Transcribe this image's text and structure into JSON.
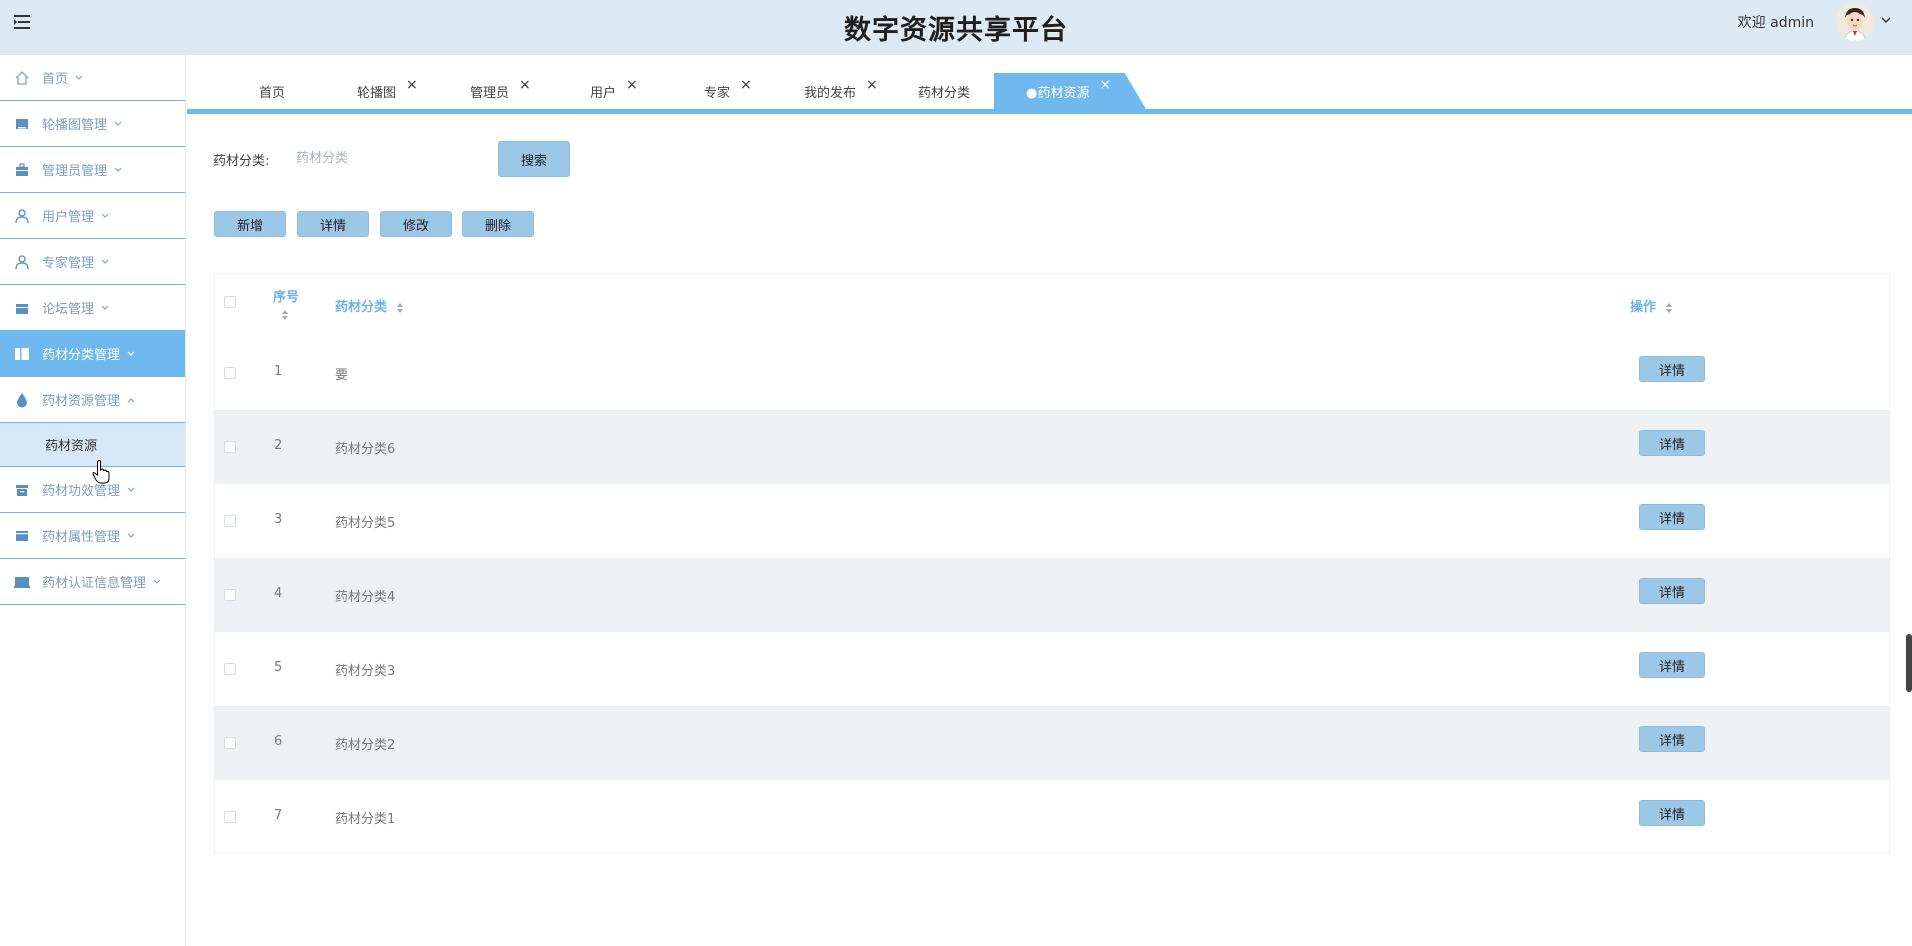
{
  "header": {
    "title": "数字资源共享平台",
    "welcome": "欢迎 admin",
    "icons": {
      "menu": "hamburger-icon",
      "avatar": "user-avatar",
      "caret": "chevron-down-icon"
    }
  },
  "sidebar": {
    "items": [
      {
        "label": "首页",
        "icon": "home-icon"
      },
      {
        "label": "轮播图管理",
        "icon": "image-icon"
      },
      {
        "label": "管理员管理",
        "icon": "briefcase-icon"
      },
      {
        "label": "用户管理",
        "icon": "user-icon"
      },
      {
        "label": "专家管理",
        "icon": "user-icon"
      },
      {
        "label": "论坛管理",
        "icon": "folder-icon"
      },
      {
        "label": "药材分类管理",
        "icon": "book-icon"
      },
      {
        "label": "药材资源管理",
        "icon": "drop-icon"
      },
      {
        "label": "药材功效管理",
        "icon": "archive-icon"
      },
      {
        "label": "药材属性管理",
        "icon": "card-icon"
      },
      {
        "label": "药材认证信息管理",
        "icon": "monitor-icon"
      }
    ],
    "submenu": {
      "label": "药材资源"
    }
  },
  "tabs": [
    {
      "label": "首页",
      "closable": false
    },
    {
      "label": "轮播图",
      "closable": true
    },
    {
      "label": "管理员",
      "closable": true
    },
    {
      "label": "用户",
      "closable": true
    },
    {
      "label": "专家",
      "closable": true
    },
    {
      "label": "我的发布",
      "closable": true
    },
    {
      "label": "药材分类",
      "closable": false
    }
  ],
  "active_tab": {
    "label": "●药材资源",
    "close": "×"
  },
  "close_glyph": "×",
  "search": {
    "label": "药材分类:",
    "placeholder": "药材分类",
    "button": "搜索"
  },
  "actions": {
    "add": "新增",
    "detail": "详情",
    "edit": "修改",
    "delete": "删除"
  },
  "table": {
    "columns": {
      "index": "序号",
      "category": "药材分类",
      "operation": "操作"
    },
    "rows": [
      {
        "index": "1",
        "category": "要",
        "action": "详情"
      },
      {
        "index": "2",
        "category": "药材分类6",
        "action": "详情"
      },
      {
        "index": "3",
        "category": "药材分类5",
        "action": "详情"
      },
      {
        "index": "4",
        "category": "药材分类4",
        "action": "详情"
      },
      {
        "index": "5",
        "category": "药材分类3",
        "action": "详情"
      },
      {
        "index": "6",
        "category": "药材分类2",
        "action": "详情"
      },
      {
        "index": "7",
        "category": "药材分类1",
        "action": "详情"
      }
    ]
  },
  "colors": {
    "header_bg": "#dde9f3",
    "accent": "#6fb9ef",
    "button_bg": "#9cc7e6",
    "row_alt": "#eef1f3"
  }
}
